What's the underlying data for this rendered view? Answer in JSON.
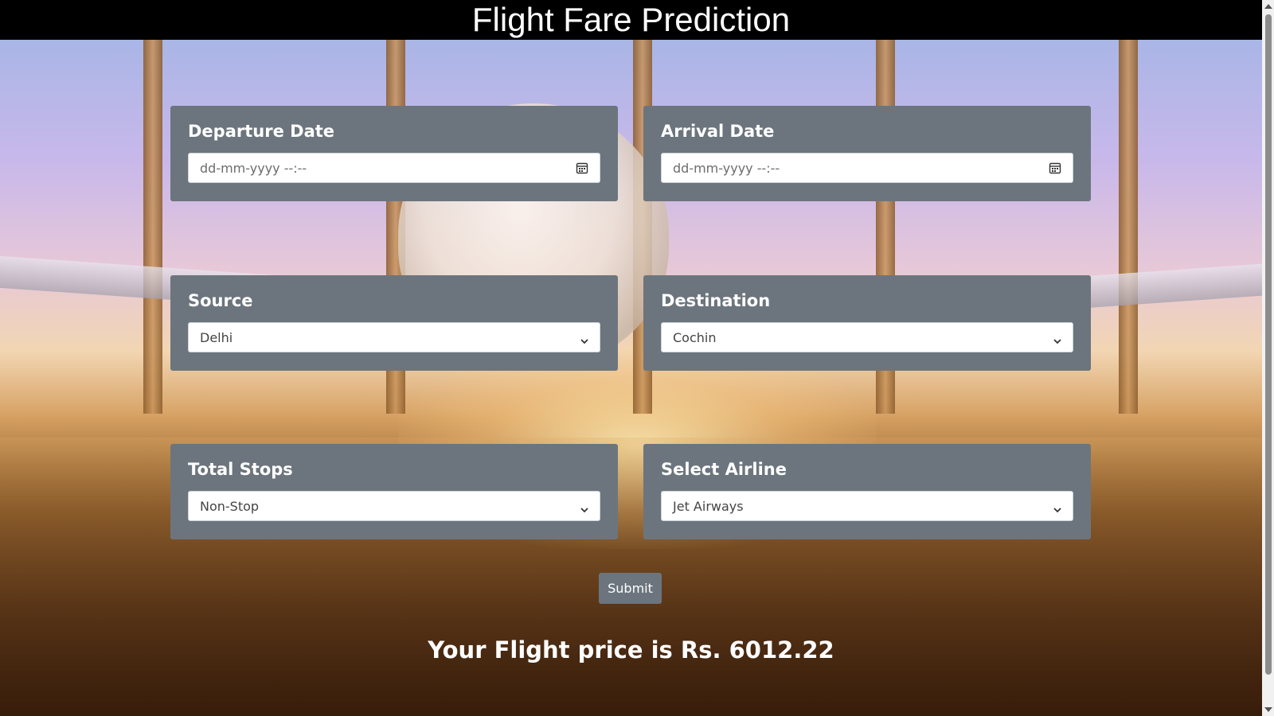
{
  "header": {
    "title": "Flight Fare Prediction"
  },
  "fields": {
    "departure": {
      "label": "Departure Date",
      "placeholder": "dd-mm-yyyy --:--",
      "icon": "calendar-icon"
    },
    "arrival": {
      "label": "Arrival Date",
      "placeholder": "dd-mm-yyyy --:--",
      "icon": "calendar-icon"
    },
    "source": {
      "label": "Source",
      "value": "Delhi",
      "icon": "chevron-down-icon"
    },
    "destination": {
      "label": "Destination",
      "value": "Cochin",
      "icon": "chevron-down-icon"
    },
    "stops": {
      "label": "Total Stops",
      "value": "Non-Stop",
      "icon": "chevron-down-icon"
    },
    "airline": {
      "label": "Select Airline",
      "value": "Jet Airways",
      "icon": "chevron-down-icon"
    }
  },
  "submit_label": "Submit",
  "result_text": "Your Flight price is Rs. 6012.22",
  "colors": {
    "card_bg": "#6c757d",
    "header_bg": "#000000",
    "text_light": "#ffffff"
  }
}
